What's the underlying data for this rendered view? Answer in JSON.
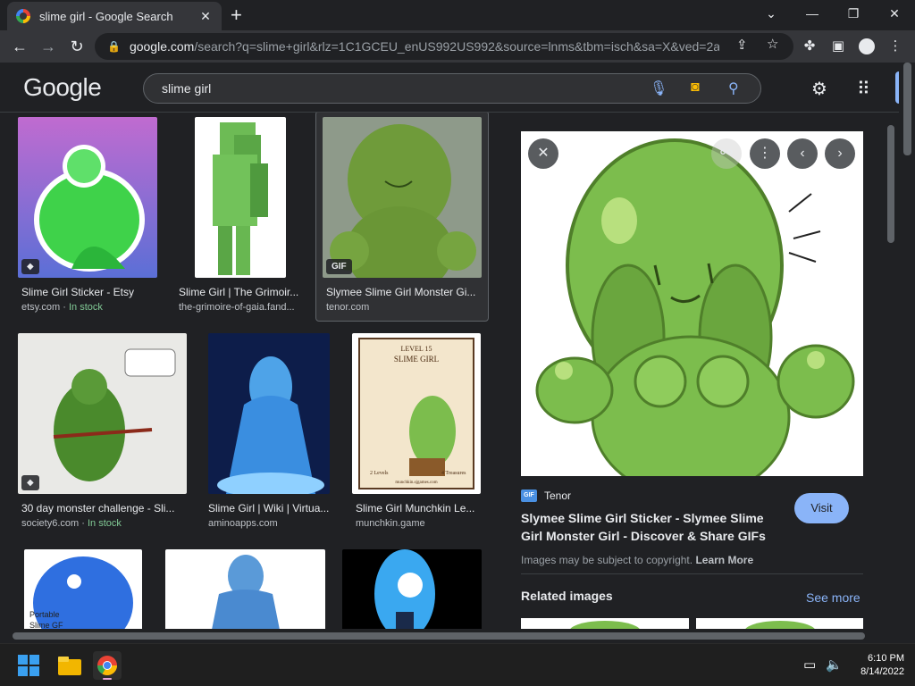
{
  "browser": {
    "tab_title": "slime girl - Google Search",
    "url_host": "google.com",
    "url_rest": "/search?q=slime+girl&rlz=1C1GCEU_enUS992US992&source=lnms&tbm=isch&sa=X&ved=2a..."
  },
  "google": {
    "logo": "Google",
    "query": "slime girl"
  },
  "results": [
    {
      "caption": "Slime Girl Sticker - Etsy",
      "source": "etsy.com",
      "extra": "In stock",
      "badge": "tag"
    },
    {
      "caption": "Slime Girl | The Grimoir...",
      "source": "the-grimoire-of-gaia.fand..."
    },
    {
      "caption": "Slymee Slime Girl Monster Gi...",
      "source": "tenor.com",
      "badge": "GIF"
    },
    {
      "caption": "30 day monster challenge - Sli...",
      "source": "society6.com",
      "extra": "In stock",
      "badge": "tag"
    },
    {
      "caption": "Slime Girl | Wiki | Virtua...",
      "source": "aminoapps.com"
    },
    {
      "caption": "Slime Girl Munchkin Le...",
      "source": "munchkin.game"
    }
  ],
  "thumb_text": {
    "card": [
      "LEVEL 15",
      "SLIME GIRL",
      "2 Levels",
      "4 Treasures",
      "munchkin.sjgames.com"
    ],
    "sticker": [
      "Portable",
      "Slime GF"
    ]
  },
  "preview": {
    "source_badge": "GIF",
    "source_name": "Tenor",
    "title": "Slymee Slime Girl Sticker - Slymee Slime Girl Monster Girl - Discover & Share GIFs",
    "visit_label": "Visit",
    "copyright_text": "Images may be subject to copyright.",
    "learn_more": "Learn More",
    "related_label": "Related images",
    "see_more": "See more"
  },
  "taskbar": {
    "time": "6:10 PM",
    "date": "8/14/2022"
  },
  "colors": {
    "bg": "#202124",
    "link": "#8ab4f8",
    "stock": "#81c995",
    "slime": "#7cbd4d"
  }
}
